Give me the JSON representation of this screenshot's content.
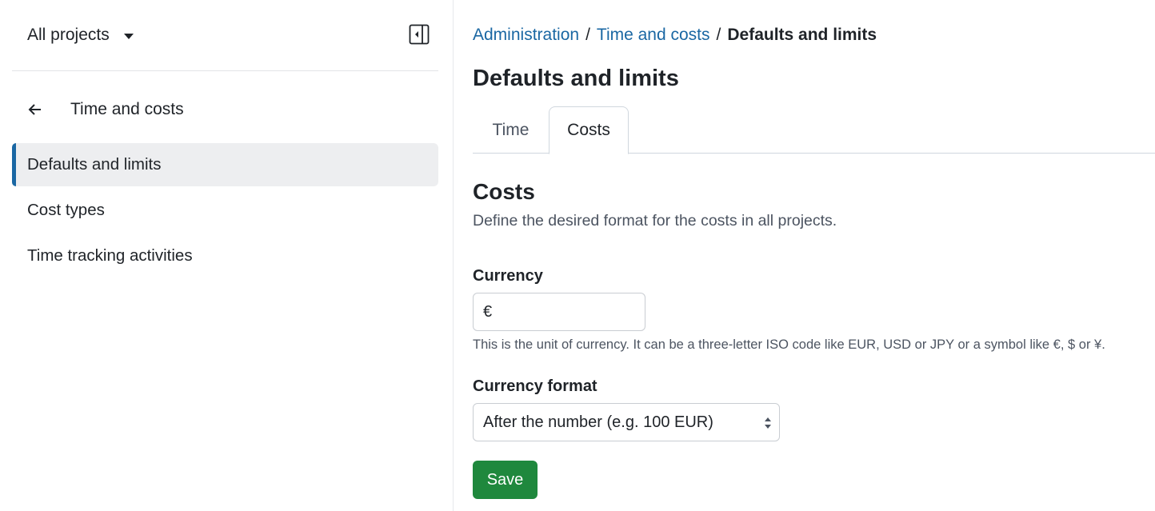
{
  "sidebar": {
    "project_selector": "All projects",
    "back_label": "Time and costs",
    "items": [
      {
        "label": "Defaults and limits",
        "active": true
      },
      {
        "label": "Cost types",
        "active": false
      },
      {
        "label": "Time tracking activities",
        "active": false
      }
    ]
  },
  "breadcrumb": {
    "items": [
      "Administration",
      "Time and costs"
    ],
    "separator": "/",
    "current": "Defaults and limits"
  },
  "page": {
    "title": "Defaults and limits"
  },
  "tabs": [
    {
      "label": "Time",
      "active": false
    },
    {
      "label": "Costs",
      "active": true
    }
  ],
  "section": {
    "title": "Costs",
    "description": "Define the desired format for the costs in all projects."
  },
  "form": {
    "currency": {
      "label": "Currency",
      "value": "€",
      "help": "This is the unit of currency. It can be a three-letter ISO code like EUR, USD or JPY or a symbol like €, $ or ¥."
    },
    "currency_format": {
      "label": "Currency format",
      "selected": "After the number (e.g. 100 EUR)"
    },
    "save_label": "Save"
  },
  "colors": {
    "link": "#1a67a3",
    "active_indicator": "#1a67a3",
    "save_button": "#1f883d"
  }
}
